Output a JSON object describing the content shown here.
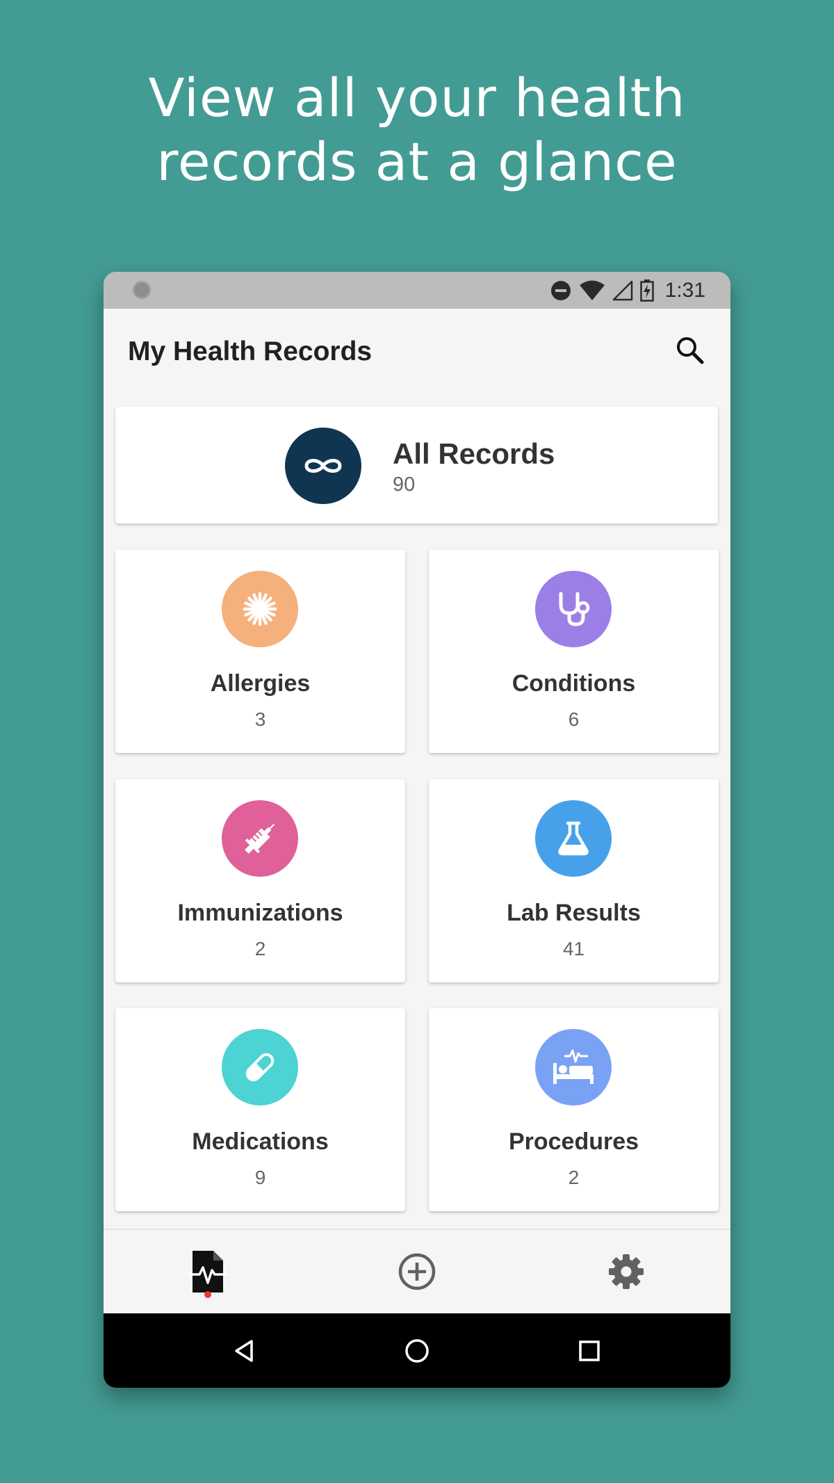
{
  "promo": {
    "headline_line1": "View all your health",
    "headline_line2": "records at a glance"
  },
  "status_bar": {
    "time": "1:31",
    "icons": [
      "do-not-disturb-icon",
      "wifi-icon",
      "cell-signal-icon",
      "battery-charging-icon"
    ]
  },
  "app_bar": {
    "title": "My Health Records",
    "search_icon": "search-icon"
  },
  "all_records": {
    "label": "All Records",
    "count": "90",
    "icon": "infinity-icon",
    "color": "#0f3550"
  },
  "categories": [
    {
      "label": "Allergies",
      "count": "3",
      "icon": "allergen-icon",
      "color": "#f5b07b"
    },
    {
      "label": "Conditions",
      "count": "6",
      "icon": "stethoscope-icon",
      "color": "#9c7fe6"
    },
    {
      "label": "Immunizations",
      "count": "2",
      "icon": "syringe-icon",
      "color": "#e0609a"
    },
    {
      "label": "Lab Results",
      "count": "41",
      "icon": "flask-icon",
      "color": "#46a1ea"
    },
    {
      "label": "Medications",
      "count": "9",
      "icon": "pill-icon",
      "color": "#4dd3d3"
    },
    {
      "label": "Procedures",
      "count": "2",
      "icon": "hospital-bed-icon",
      "color": "#7aa2f4"
    }
  ],
  "bottom_nav": {
    "items": [
      "records-icon",
      "add-circle-icon",
      "settings-icon"
    ],
    "active": "records-icon",
    "indicator_color": "#e53935"
  },
  "system_nav": {
    "items": [
      "back-icon",
      "home-icon",
      "recents-icon"
    ]
  }
}
